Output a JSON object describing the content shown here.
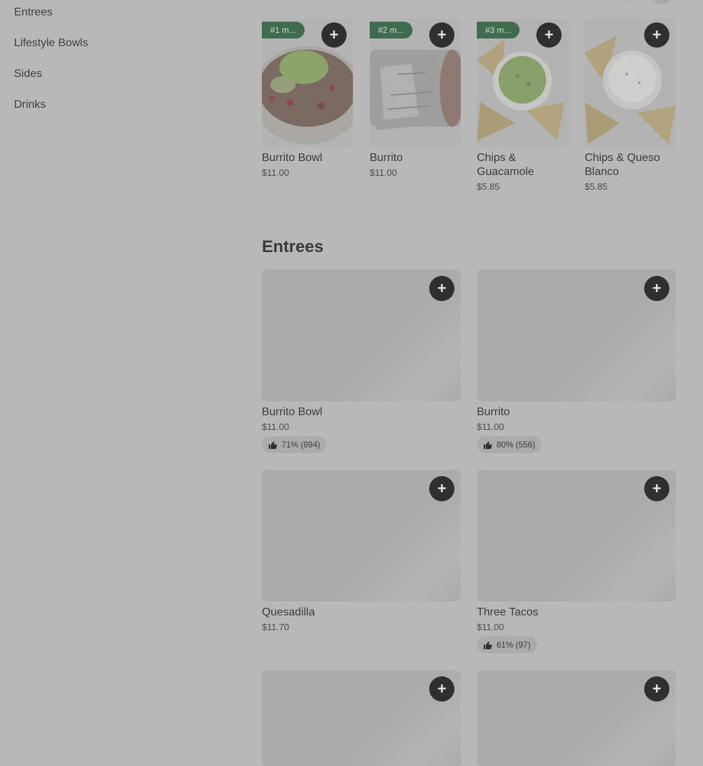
{
  "sidebar": {
    "items": [
      {
        "label": "Entrees"
      },
      {
        "label": "Lifestyle Bowls"
      },
      {
        "label": "Sides"
      },
      {
        "label": "Drinks"
      }
    ]
  },
  "popular": {
    "cards": [
      {
        "badge": "#1 m...",
        "name": "Burrito Bowl",
        "price": "$11.00",
        "icon": "burrito-bowl-image"
      },
      {
        "badge": "#2 m...",
        "name": "Burrito",
        "price": "$11.00",
        "icon": "burrito-image"
      },
      {
        "badge": "#3 m...",
        "name": "Chips & Guacamole",
        "price": "$5.85",
        "icon": "guacamole-image"
      },
      {
        "badge": "",
        "name": "Chips & Queso Blanco",
        "price": "$5.85",
        "icon": "queso-image"
      }
    ]
  },
  "entrees": {
    "title": "Entrees",
    "cards": [
      {
        "name": "Burrito Bowl",
        "price": "$11.00",
        "rating": "71% (894)"
      },
      {
        "name": "Burrito",
        "price": "$11.00",
        "rating": "80% (556)"
      },
      {
        "name": "Quesadilla",
        "price": "$11.70",
        "rating": ""
      },
      {
        "name": "Three Tacos",
        "price": "$11.00",
        "rating": "61% (97)"
      },
      {
        "name": "",
        "price": "",
        "rating": ""
      },
      {
        "name": "",
        "price": "",
        "rating": ""
      }
    ]
  },
  "add_label": "+",
  "colors": {
    "overlay_bg": "#b8b8b8",
    "badge_green": "#3f6b4f",
    "add_button": "#2f2f2f"
  }
}
